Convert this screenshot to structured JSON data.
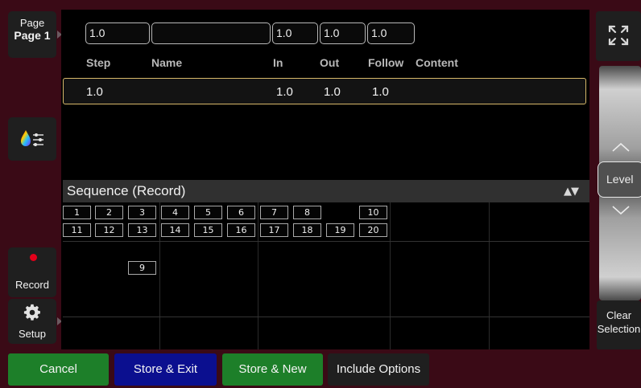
{
  "sidebar": {
    "page": {
      "label": "Page",
      "value": "Page 1"
    },
    "color_icon": "color-picker-icon",
    "record": {
      "label": "Record",
      "indicator_color": "#e3001a"
    },
    "setup": {
      "label": "Setup",
      "icon": "gear-icon"
    }
  },
  "editor": {
    "fields": {
      "step": "1.0",
      "name": "",
      "in": "1.0",
      "out": "1.0",
      "follow": "1.0"
    },
    "headers": {
      "step": "Step",
      "name": "Name",
      "in": "In",
      "out": "Out",
      "follow": "Follow",
      "content": "Content"
    },
    "selected_row": {
      "step": "1.0",
      "in": "1.0",
      "out": "1.0",
      "follow": "1.0"
    }
  },
  "sequence": {
    "title": "Sequence (Record)",
    "sort_icon": "▲▼",
    "cues_row1": [
      "1",
      "2",
      "3",
      "4",
      "5",
      "6",
      "7",
      "8",
      "10"
    ],
    "cues_row2": [
      "11",
      "12",
      "13",
      "14",
      "15",
      "16",
      "17",
      "18",
      "19",
      "20"
    ],
    "cue_extra": "9"
  },
  "right_panel": {
    "zoom_icon": "fullscreen-icon",
    "level_label": "Level",
    "clear_label_line1": "Clear",
    "clear_label_line2": "Selection"
  },
  "toolbar": {
    "cancel": "Cancel",
    "store_exit": "Store & Exit",
    "store_new": "Store & New",
    "include_options": "Include Options"
  },
  "colors": {
    "frame": "#3a0a16",
    "green": "#1d7f29",
    "blue": "#0b0f8f",
    "selection_border": "#d7b86a"
  }
}
